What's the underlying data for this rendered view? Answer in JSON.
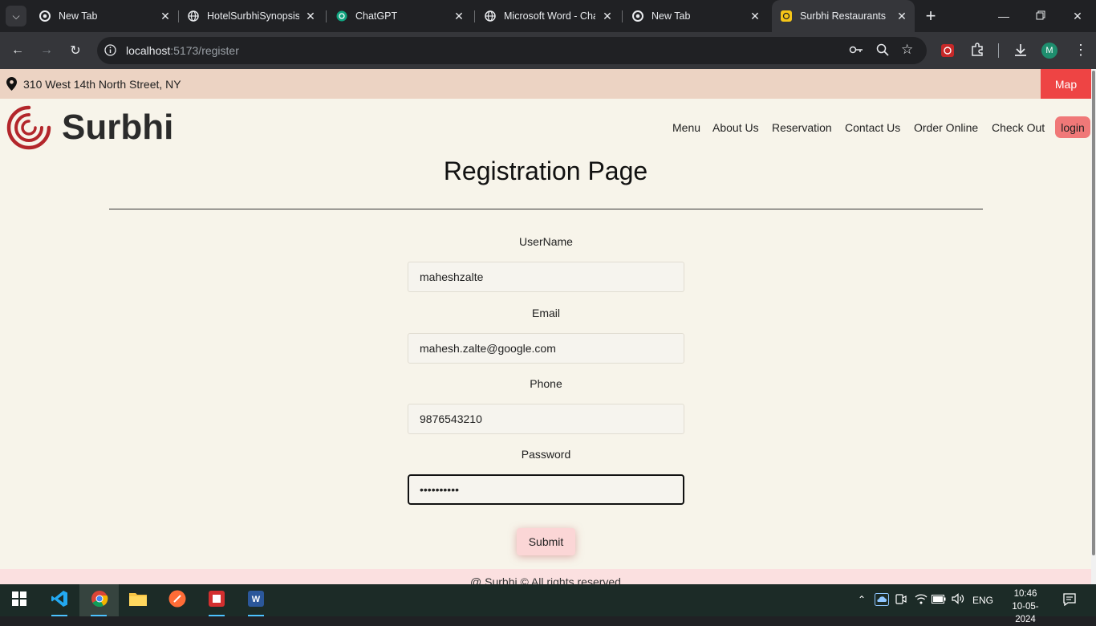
{
  "browser": {
    "tabs": [
      {
        "title": "New Tab",
        "favicon": "chrome-icon"
      },
      {
        "title": "HotelSurbhiSynopsis.p",
        "favicon": "globe-icon"
      },
      {
        "title": "ChatGPT",
        "favicon": "chatgpt-icon"
      },
      {
        "title": "Microsoft Word - Cha",
        "favicon": "globe-icon"
      },
      {
        "title": "New Tab",
        "favicon": "chrome-icon"
      },
      {
        "title": "Surbhi Restaurants",
        "favicon": "site-icon"
      }
    ],
    "url_host": "localhost",
    "url_path": ":5173/register",
    "profile_initial": "M"
  },
  "site": {
    "address": "310 West 14th North Street, NY",
    "map_label": "Map",
    "brand": "Surbhi",
    "nav": [
      "Menu",
      "About Us",
      "Reservation",
      "Contact Us",
      "Order Online",
      "Check Out"
    ],
    "login_label": "login"
  },
  "form": {
    "title": "Registration Page",
    "username_label": "UserName",
    "username_value": "maheshzalte",
    "email_label": "Email",
    "email_value": "mahesh.zalte@google.com",
    "phone_label": "Phone",
    "phone_value": "9876543210",
    "password_label": "Password",
    "password_value": "mahesh1234",
    "submit_label": "Submit"
  },
  "footer": {
    "text": "@ Surbhi © All rights reserved"
  },
  "taskbar": {
    "language": "ENG",
    "time": "10:46",
    "date": "10-05-2024"
  },
  "colors": {
    "topbar": "#ecd3c3",
    "map_button": "#ee4444",
    "login_button": "#f07878",
    "page_bg": "#f7f4ea",
    "brand_logo": "#b3262b"
  }
}
